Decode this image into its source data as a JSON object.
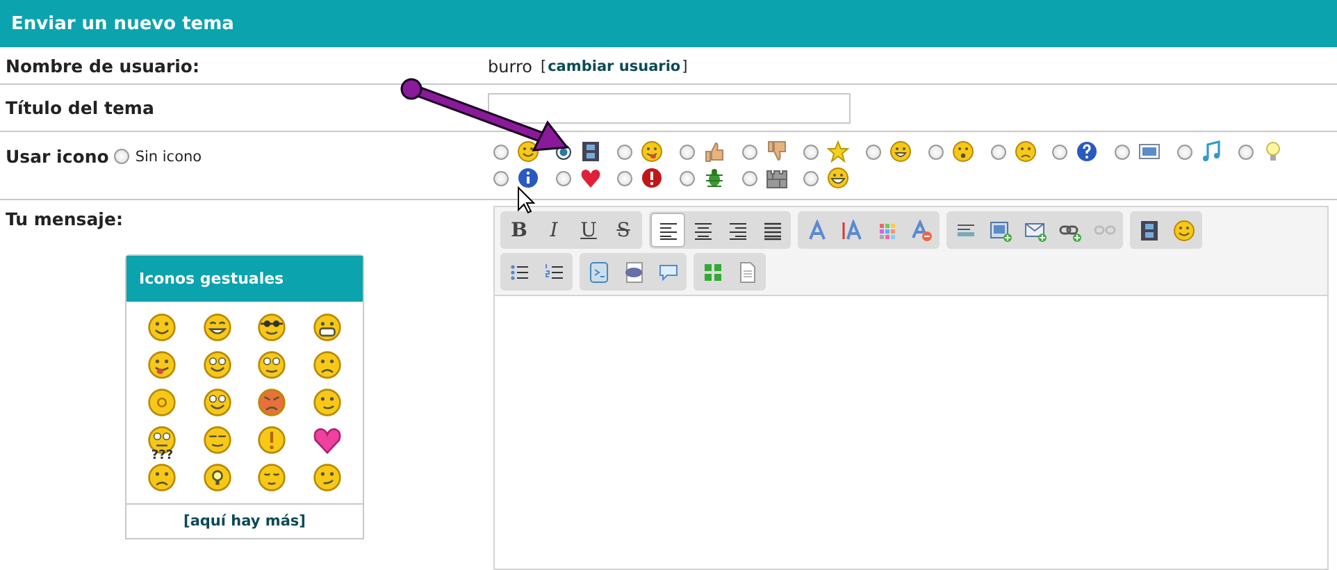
{
  "header": {
    "title": "Enviar un nuevo tema"
  },
  "username_row": {
    "label": "Nombre de usuario:",
    "value": "burro",
    "link_open": "[",
    "link": "cambiar usuario",
    "link_close": "]"
  },
  "title_row": {
    "label": "Título del tema"
  },
  "icon_row": {
    "label": "Usar icono",
    "none_option": {
      "label": "Sin icono",
      "selected": false
    },
    "options": [
      {
        "kind": "smiley",
        "selected": false
      },
      {
        "kind": "film",
        "selected": true
      },
      {
        "kind": "tongue",
        "selected": false
      },
      {
        "kind": "thumb-up",
        "selected": false
      },
      {
        "kind": "thumb-down",
        "selected": false
      },
      {
        "kind": "star",
        "selected": false
      },
      {
        "kind": "grin",
        "selected": false
      },
      {
        "kind": "surprised",
        "selected": false
      },
      {
        "kind": "sad",
        "selected": false
      },
      {
        "kind": "question",
        "selected": false
      },
      {
        "kind": "image",
        "selected": false
      },
      {
        "kind": "music",
        "selected": false
      },
      {
        "kind": "bulb",
        "selected": false
      },
      {
        "kind": "info",
        "selected": false
      },
      {
        "kind": "heart",
        "selected": false
      },
      {
        "kind": "exclamation",
        "selected": false
      },
      {
        "kind": "bug",
        "selected": false
      },
      {
        "kind": "wall",
        "selected": false
      },
      {
        "kind": "big-grin",
        "selected": false
      }
    ]
  },
  "message_row": {
    "label": "Tu mensaje:"
  },
  "emoticons_panel": {
    "title": "Iconos gestuales",
    "caption": "???",
    "more_link": "[aquí hay más]"
  },
  "toolbar": {
    "rows": [
      [
        [
          {
            "kind": "bold",
            "label": "B",
            "selected": false
          },
          {
            "kind": "italic",
            "label": "I",
            "selected": false
          },
          {
            "kind": "underline",
            "label": "U",
            "selected": false
          },
          {
            "kind": "strike",
            "label": "S",
            "selected": false
          }
        ],
        [
          {
            "kind": "align-left",
            "selected": true
          },
          {
            "kind": "align-center",
            "selected": false
          },
          {
            "kind": "align-right",
            "selected": false
          },
          {
            "kind": "justify",
            "selected": false
          }
        ],
        [
          {
            "kind": "font",
            "selected": false
          },
          {
            "kind": "font-size",
            "selected": false
          },
          {
            "kind": "color",
            "selected": false
          },
          {
            "kind": "remove-format",
            "selected": false
          }
        ],
        [
          {
            "kind": "rule",
            "selected": false
          },
          {
            "kind": "image",
            "selected": false
          },
          {
            "kind": "email",
            "selected": false
          },
          {
            "kind": "link",
            "selected": false
          },
          {
            "kind": "unlink",
            "selected": false
          }
        ],
        [
          {
            "kind": "video",
            "selected": false
          },
          {
            "kind": "emoticon",
            "selected": false
          }
        ]
      ],
      [
        [
          {
            "kind": "bullet-list",
            "selected": false
          },
          {
            "kind": "number-list",
            "selected": false
          }
        ],
        [
          {
            "kind": "code",
            "selected": false
          },
          {
            "kind": "php",
            "selected": false
          },
          {
            "kind": "quote",
            "selected": false
          }
        ],
        [
          {
            "kind": "grid",
            "selected": false
          },
          {
            "kind": "document",
            "selected": false
          }
        ]
      ]
    ]
  }
}
